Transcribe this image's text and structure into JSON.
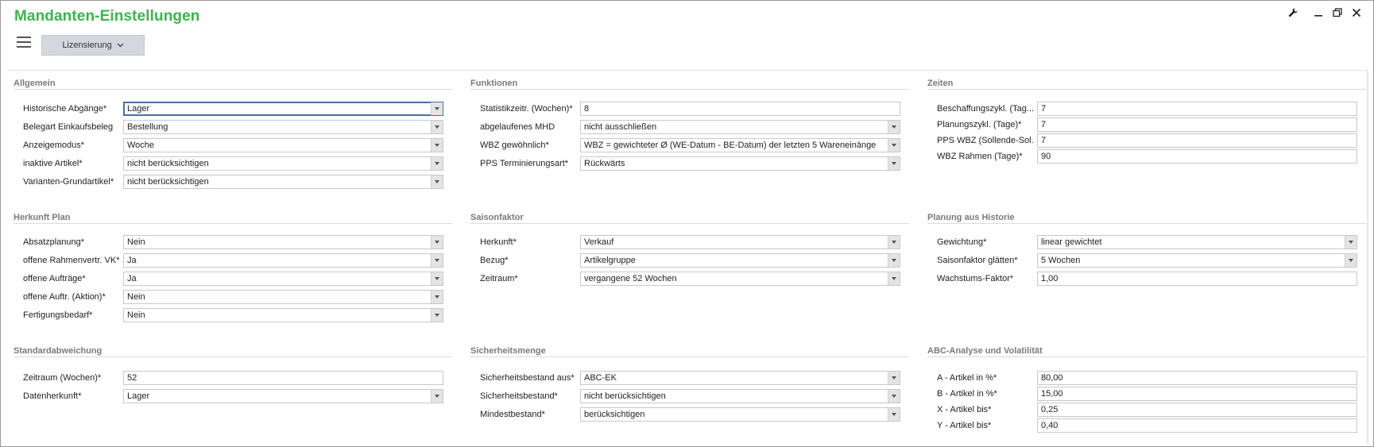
{
  "window": {
    "title": "Mandanten-Einstellungen",
    "controls": {
      "wrench": "wrench-icon",
      "minimize": "minimize-icon",
      "restore": "restore-icon",
      "close": "close-icon"
    }
  },
  "toolbar": {
    "menu_icon": "hamburger-icon",
    "tab_label": "Lizensierung",
    "tab_chevron": "chevron-down-icon"
  },
  "colors": {
    "title": "#3cb44b",
    "active_border": "#4a6fa8",
    "section_title": "#7a7a7a"
  },
  "sections": {
    "allgemein": {
      "title": "Allgemein",
      "rows": [
        {
          "label": "Historische Abgänge*",
          "value": "Lager"
        },
        {
          "label": "Belegart Einkaufsbeleg",
          "value": "Bestellung"
        },
        {
          "label": "Anzeigemodus*",
          "value": "Woche"
        },
        {
          "label": "inaktive Artikel*",
          "value": "nicht berücksichtigen"
        },
        {
          "label": "Varianten-Grundartikel*",
          "value": "nicht berücksichtigen"
        }
      ]
    },
    "funktionen": {
      "title": "Funktionen",
      "rows": [
        {
          "label": "Statistikzeitr. (Wochen)*",
          "value": "8"
        },
        {
          "label": "abgelaufenes MHD",
          "value": "nicht ausschließen"
        },
        {
          "label": "WBZ gewöhnlich*",
          "value": "WBZ = gewichteter Ø (WE-Datum - BE-Datum) der letzten 5 Wareneinänge"
        },
        {
          "label": "PPS Terminierungsart*",
          "value": "Rückwärts"
        }
      ]
    },
    "zeiten": {
      "title": "Zeiten",
      "rows": [
        {
          "label": "Beschaffungszykl. (Tag...",
          "value": "7"
        },
        {
          "label": "Planungszykl. (Tage)*",
          "value": "7"
        },
        {
          "label": "PPS WBZ (Sollende-Sol...",
          "value": "7"
        },
        {
          "label": "WBZ Rahmen (Tage)*",
          "value": "90"
        }
      ]
    },
    "herkunft_plan": {
      "title": "Herkunft Plan",
      "rows": [
        {
          "label": "Absatzplanung*",
          "value": "Nein"
        },
        {
          "label": "offene Rahmenvertr. VK*",
          "value": "Ja"
        },
        {
          "label": "offene Aufträge*",
          "value": "Ja"
        },
        {
          "label": "offene Auftr. (Aktion)*",
          "value": "Nein"
        },
        {
          "label": "Fertigungsbedarf*",
          "value": "Nein"
        }
      ]
    },
    "saisonfaktor": {
      "title": "Saisonfaktor",
      "rows": [
        {
          "label": "Herkunft*",
          "value": "Verkauf"
        },
        {
          "label": "Bezug*",
          "value": "Artikelgruppe"
        },
        {
          "label": "Zeitraum*",
          "value": "vergangene 52 Wochen"
        }
      ]
    },
    "planung_historie": {
      "title": "Planung aus Historie",
      "rows": [
        {
          "label": "Gewichtung*",
          "value": "linear gewichtet"
        },
        {
          "label": "Saisonfaktor glätten*",
          "value": "5 Wochen"
        },
        {
          "label": "Wachstums-Faktor*",
          "value": "1,00"
        }
      ]
    },
    "standardabweichung": {
      "title": "Standardabweichung",
      "rows": [
        {
          "label": "Zeitraum (Wochen)*",
          "value": "52"
        },
        {
          "label": "Datenherkunft*",
          "value": "Lager"
        }
      ]
    },
    "sicherheitsmenge": {
      "title": "Sicherheitsmenge",
      "rows": [
        {
          "label": "Sicherheitsbestand aus*",
          "value": "ABC-EK"
        },
        {
          "label": "Sicherheitsbestand*",
          "value": "nicht berücksichtigen"
        },
        {
          "label": "Mindestbestand*",
          "value": "berücksichtigen"
        }
      ]
    },
    "abc": {
      "title": "ABC-Analyse und Volatilität",
      "rows": [
        {
          "label": "A - Artikel in %*",
          "value": "80,00"
        },
        {
          "label": "B - Artikel in %*",
          "value": "15,00"
        },
        {
          "label": "X - Artikel bis*",
          "value": "0,25"
        },
        {
          "label": "Y - Artikel bis*",
          "value": "0,40"
        }
      ]
    }
  }
}
